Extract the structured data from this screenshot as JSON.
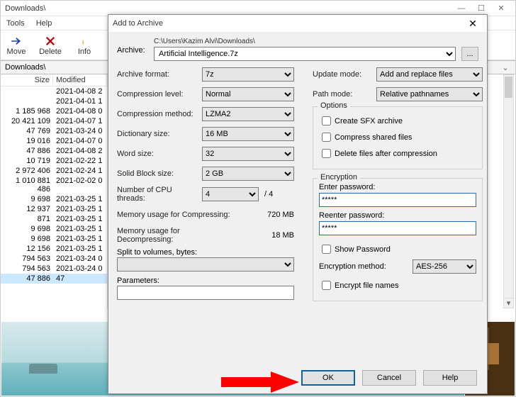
{
  "bg": {
    "title": "Downloads\\",
    "menu": {
      "tools": "Tools",
      "help": "Help"
    },
    "toolbar": {
      "move": "Move",
      "delete": "Delete",
      "info": "Info"
    },
    "breadcrumb": "Downloads\\",
    "cols": {
      "size": "Size",
      "modified": "Modified"
    },
    "rows": [
      {
        "size": "",
        "mod": "2021-04-08 2"
      },
      {
        "size": "",
        "mod": "2021-04-01 1"
      },
      {
        "size": "1 185 968",
        "mod": "2021-04-08 0"
      },
      {
        "size": "20 421 109",
        "mod": "2021-04-07 1"
      },
      {
        "size": "47 769",
        "mod": "2021-03-24 0"
      },
      {
        "size": "19 016",
        "mod": "2021-04-07 0"
      },
      {
        "size": "47 886",
        "mod": "2021-04-08 2"
      },
      {
        "size": "10 719",
        "mod": "2021-02-22 1"
      },
      {
        "size": "2 972 406",
        "mod": "2021-02-24 1"
      },
      {
        "size": "1 010 881 486",
        "mod": "2021-02-02 0"
      },
      {
        "size": "9 698",
        "mod": "2021-03-25 1"
      },
      {
        "size": "12 937",
        "mod": "2021-03-25 1"
      },
      {
        "size": "871",
        "mod": "2021-03-25 1"
      },
      {
        "size": "9 698",
        "mod": "2021-03-25 1"
      },
      {
        "size": "9 698",
        "mod": "2021-03-25 1"
      },
      {
        "size": "12 156",
        "mod": "2021-03-25 1"
      },
      {
        "size": "794 563",
        "mod": "2021-03-24 0"
      },
      {
        "size": "794 563",
        "mod": "2021-03-24 0"
      },
      {
        "size": "47 886",
        "mod": "47",
        "sel": true
      }
    ]
  },
  "dlg": {
    "title": "Add to Archive",
    "archive_lbl": "Archive:",
    "path_text": "C:\\Users\\Kazim Alvi\\Downloads\\",
    "archive_name": "Artificial Intelligence.7z",
    "browse_label": "...",
    "left": {
      "format_lbl": "Archive format:",
      "format_val": "7z",
      "level_lbl": "Compression level:",
      "level_val": "Normal",
      "method_lbl": "Compression method:",
      "method_val": "LZMA2",
      "dict_lbl": "Dictionary size:",
      "dict_val": "16 MB",
      "word_lbl": "Word size:",
      "word_val": "32",
      "block_lbl": "Solid Block size:",
      "block_val": "2 GB",
      "cpu_lbl": "Number of CPU threads:",
      "cpu_val": "4",
      "cpu_total": "/ 4",
      "mem_c_lbl": "Memory usage for Compressing:",
      "mem_c_val": "720 MB",
      "mem_d_lbl": "Memory usage for Decompressing:",
      "mem_d_val": "18 MB",
      "split_lbl": "Split to volumes, bytes:",
      "params_lbl": "Parameters:"
    },
    "right": {
      "update_lbl": "Update mode:",
      "update_val": "Add and replace files",
      "path_lbl": "Path mode:",
      "path_val": "Relative pathnames",
      "options_title": "Options",
      "sfx": "Create SFX archive",
      "shared": "Compress shared files",
      "delafter": "Delete files after compression",
      "enc_title": "Encryption",
      "pwd1_lbl": "Enter password:",
      "pwd1_val": "*****",
      "pwd2_lbl": "Reenter password:",
      "pwd2_val": "*****",
      "showpwd": "Show Password",
      "encmethod_lbl": "Encryption method:",
      "encmethod_val": "AES-256",
      "encnames": "Encrypt file names"
    },
    "buttons": {
      "ok": "OK",
      "cancel": "Cancel",
      "help": "Help"
    }
  }
}
